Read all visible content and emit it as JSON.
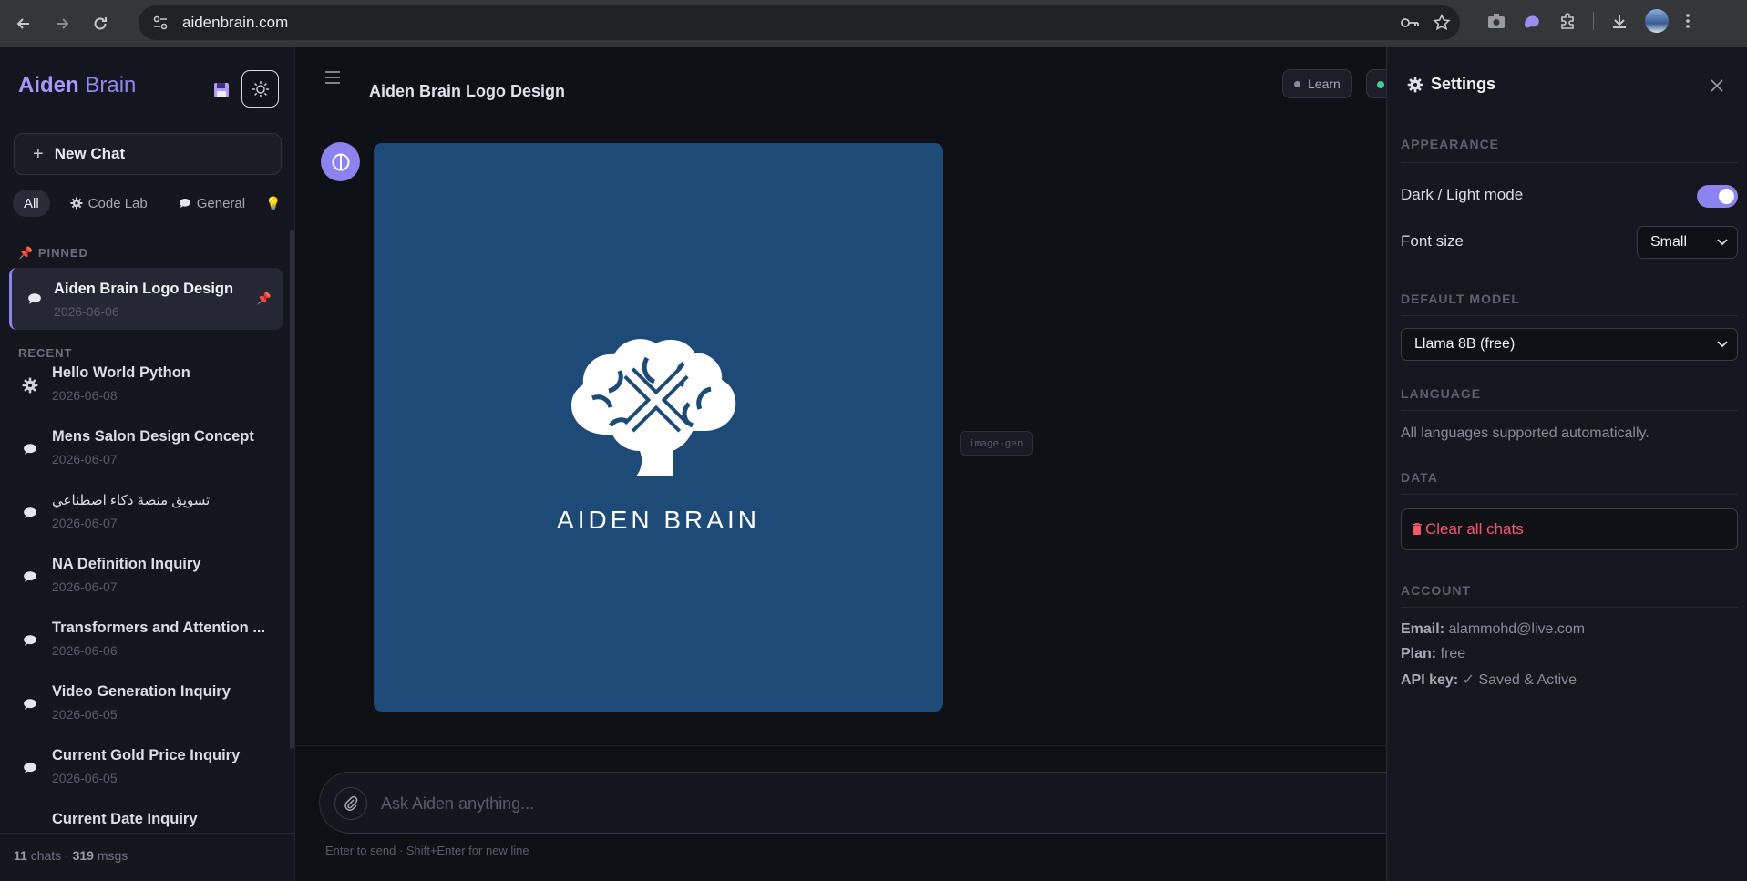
{
  "browser": {
    "url": "aidenbrain.com"
  },
  "sidebar": {
    "brand_1": "Aiden",
    "brand_2": "Brain",
    "new_chat": "New Chat",
    "filters": [
      "All",
      "Code Lab",
      "General"
    ],
    "pinned_label": "PINNED",
    "recent_label": "RECENT",
    "pinned": [
      {
        "title": "Aiden Brain Logo Design",
        "date": "2026-06-06"
      }
    ],
    "recent": [
      {
        "title": "Hello World Python",
        "date": "2026-06-08",
        "icon": "gear-icon"
      },
      {
        "title": "Mens Salon Design Concept",
        "date": "2026-06-07",
        "icon": "chat-bubble-icon"
      },
      {
        "title": "تسويق منصة ذكاء اصطناعي",
        "date": "2026-06-07",
        "icon": "chat-bubble-icon"
      },
      {
        "title": "NA Definition Inquiry",
        "date": "2026-06-07",
        "icon": "chat-bubble-icon"
      },
      {
        "title": "Transformers and Attention ...",
        "date": "2026-06-06",
        "icon": "chat-bubble-icon"
      },
      {
        "title": "Video Generation Inquiry",
        "date": "2026-06-05",
        "icon": "chat-bubble-icon"
      },
      {
        "title": "Current Gold Price Inquiry",
        "date": "2026-06-05",
        "icon": "chat-bubble-icon"
      },
      {
        "title": "Current Date Inquiry",
        "date": "",
        "icon": "chat-bubble-icon"
      }
    ],
    "footer_chats": "11",
    "footer_chats_label": "chats ·",
    "footer_msgs": "319",
    "footer_msgs_label": "msgs"
  },
  "main": {
    "title": "Aiden Brain Logo Design",
    "learn": "Learn",
    "logo_text": "AIDEN BRAIN",
    "tag": "image-gen",
    "input_placeholder": "Ask Aiden anything...",
    "hint": "Enter to send · Shift+Enter for new line"
  },
  "settings": {
    "title": "Settings",
    "appearance": "APPEARANCE",
    "dark_light": "Dark / Light mode",
    "dark_light_on": true,
    "font_size_label": "Font size",
    "font_size_value": "Small",
    "default_model": "DEFAULT MODEL",
    "model_value": "Llama 8B (free)",
    "language": "LANGUAGE",
    "language_text": "All languages supported automatically.",
    "data": "DATA",
    "clear_chats": "Clear all chats",
    "account": "ACCOUNT",
    "email_label": "Email:",
    "email_value": "alammohd@live.com",
    "plan_label": "Plan:",
    "plan_value": "free",
    "api_label": "API key:",
    "api_value": "✓ Saved & Active"
  },
  "colors": {
    "accent": "#8c82f0",
    "danger": "#f05a6e",
    "logo_bg": "#1e4a78"
  }
}
